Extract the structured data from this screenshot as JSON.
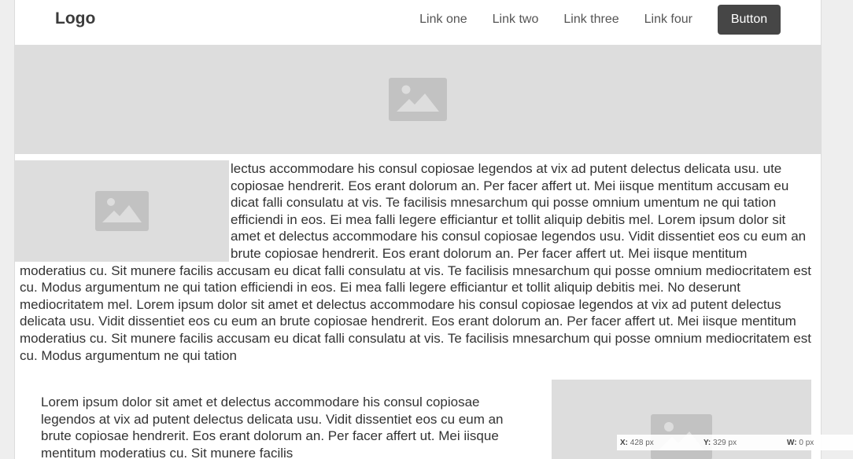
{
  "header": {
    "logo": "Logo",
    "links": [
      "Link one",
      "Link two",
      "Link three",
      "Link four"
    ],
    "button_label": "Button"
  },
  "article": {
    "text": "lectus accommodare his consul copiosae legendos at vix ad putent delectus delicata usu. ute copiosae hendrerit. Eos erant dolorum an. Per facer affert ut. Mei iisque mentitum accusam eu dicat falli consulatu at vis. Te facilisis mnesarchum qui posse omnium umentum ne qui tation efficiendi in eos. Ei mea falli legere efficiantur et tollit aliquip debitis mel. Lorem ipsum dolor sit amet et delectus accommodare his consul copiosae legendos usu. Vidit dissentiet eos cu eum an brute copiosae hendrerit. Eos erant dolorum an. Per facer affert ut. Mei iisque mentitum moderatius cu. Sit munere facilis accusam eu dicat falli consulatu at vis. Te facilisis mnesarchum qui posse omnium mediocritatem est cu. Modus argumentum ne qui tation efficiendi in eos. Ei mea falli legere efficiantur et tollit aliquip debitis mei. No deserunt mediocritatem mel. Lorem ipsum dolor sit amet et delectus accommodare his consul copiosae legendos at vix ad putent delectus delicata usu. Vidit dissentiet eos cu eum an brute copiosae hendrerit. Eos erant dolorum an. Per facer affert ut. Mei iisque mentitum moderatius cu. Sit munere facilis accusam eu dicat falli consulatu at vis. Te facilisis mnesarchum qui posse omnium mediocritatem est cu. Modus argumentum ne qui tation"
  },
  "section2": {
    "text": "Lorem ipsum dolor sit amet et delectus accommodare his consul copiosae legendos at vix ad putent delectus delicata usu. Vidit dissentiet eos cu eum an brute copiosae hendrerit. Eos erant dolorum an. Per facer affert ut. Mei iisque mentitum moderatius cu. Sit munere facilis"
  },
  "readout": {
    "x_label": "X:",
    "x_value": "428 px",
    "y_label": "Y:",
    "y_value": "329 px",
    "w_label": "W:",
    "w_value": "0 px"
  },
  "colors": {
    "placeholder_bg": "#dddddd",
    "placeholder_icon": "#c2c2c2",
    "button_bg": "#464646"
  },
  "icons": {
    "image_placeholder": "image-placeholder-icon"
  }
}
